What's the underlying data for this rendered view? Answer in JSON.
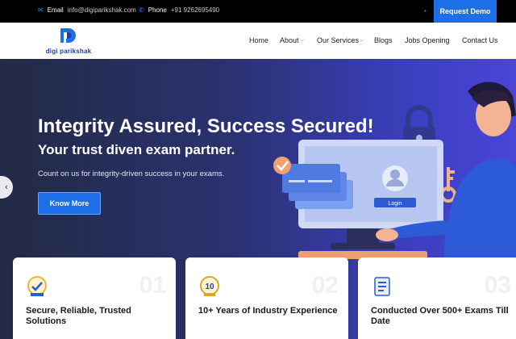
{
  "topbar": {
    "email_label": "Email",
    "email_value": "info@digiparikshak.com",
    "phone_label": "Phone",
    "phone_value": "+91 9262695490",
    "request_demo": "Request Demo"
  },
  "logo": {
    "text": "digi parikshak"
  },
  "nav": {
    "items": [
      {
        "label": "Home",
        "has_dropdown": false
      },
      {
        "label": "About",
        "has_dropdown": true
      },
      {
        "label": "Our Services",
        "has_dropdown": true
      },
      {
        "label": "Blogs",
        "has_dropdown": false
      },
      {
        "label": "Jobs Opening",
        "has_dropdown": false
      },
      {
        "label": "Contact Us",
        "has_dropdown": false
      }
    ]
  },
  "hero": {
    "title": "Integrity Assured, Success Secured!",
    "subtitle": "Your trust diven exam partner.",
    "description": "Count on us for integrity-driven success in your exams.",
    "cta": "Know More",
    "login_label": "Login"
  },
  "cards": [
    {
      "number": "01",
      "title": "Secure, Reliable, Trusted Solutions",
      "icon": "badge-icon"
    },
    {
      "number": "02",
      "title": "10+ Years of Industry Experience",
      "icon": "anniversary-icon"
    },
    {
      "number": "03",
      "title": "Conducted Over 500+ Exams Till Date",
      "icon": "document-icon"
    }
  ],
  "colors": {
    "accent": "#1d6fe8",
    "hero_dark": "#232a45",
    "hero_light": "#4a45d6"
  }
}
